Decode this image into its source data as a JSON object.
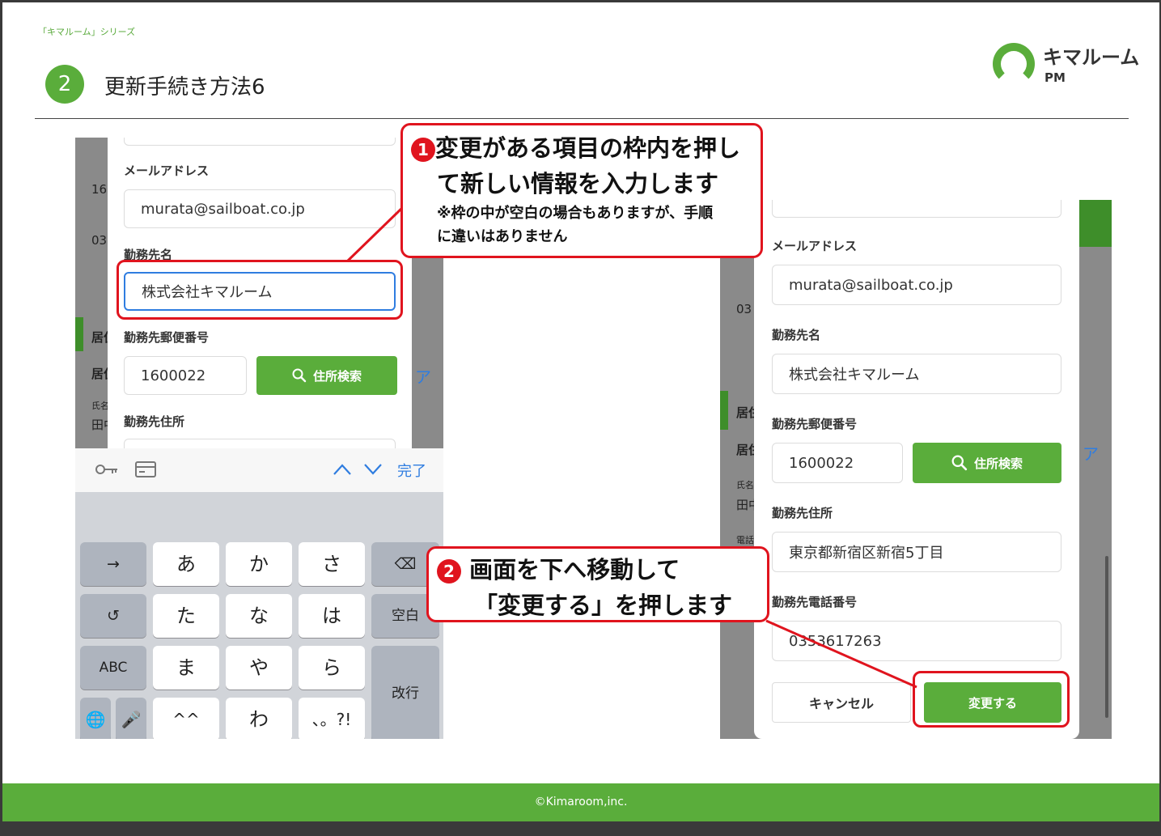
{
  "header": {
    "series": "「キマルーム」シリーズ",
    "step_number": "2",
    "title": "更新手続き方法6"
  },
  "logo": {
    "name": "キマルーム",
    "sub": "PM"
  },
  "footer": {
    "copyright": "©Kimaroom,inc."
  },
  "left_screen": {
    "background_fragments": [
      "16",
      "03",
      "居住",
      "居住",
      "氏名",
      "田中",
      "ア"
    ],
    "email_label": "メールアドレス",
    "email_value": "murata@sailboat.co.jp",
    "company_label": "勤務先名",
    "company_value": "株式会社キマルーム",
    "zip_label": "勤務先郵便番号",
    "zip_value": "1600022",
    "address_search_button": "住所検索",
    "address_label": "勤務先住所",
    "keyboard_toolbar": {
      "done": "完了"
    },
    "keyboard": {
      "row1": [
        "→",
        "あ",
        "か",
        "さ",
        "⌫"
      ],
      "row2": [
        "↺",
        "た",
        "な",
        "は",
        "空白"
      ],
      "row3": [
        "ABC",
        "ま",
        "や",
        "ら"
      ],
      "row4": [
        "🌐",
        "🎤",
        "^^",
        "わ",
        "、。?!"
      ],
      "enter": "改行"
    }
  },
  "right_screen": {
    "background_fragments": [
      "03",
      "居住",
      "居住",
      "氏名",
      "田中",
      "電話",
      "ア"
    ],
    "email_label": "メールアドレス",
    "email_value": "murata@sailboat.co.jp",
    "company_label": "勤務先名",
    "company_value": "株式会社キマルーム",
    "zip_label": "勤務先郵便番号",
    "zip_value": "1600022",
    "address_search_button": "住所検索",
    "address_label": "勤務先住所",
    "address_value": "東京都新宿区新宿5丁目",
    "phone_label": "勤務先電話番号",
    "phone_value": "0353617263",
    "cancel_button": "キャンセル",
    "submit_button": "変更する"
  },
  "callout1": {
    "badge": "1",
    "line1": "変更がある項目の枠内を押し",
    "line2": "て新しい情報を入力します",
    "note1": "※枠の中が空白の場合もありますが、手順",
    "note2": "に違いはありません"
  },
  "callout2": {
    "badge": "2",
    "line1": "画面を下へ移動して",
    "line2": "「変更する」を押します"
  },
  "colors": {
    "brand_green": "#5aad3b",
    "callout_red": "#e0141e",
    "link_blue": "#2f7de0"
  },
  "icons": [
    "search-icon",
    "key-icon",
    "card-icon",
    "chevron-up-icon",
    "chevron-down-icon",
    "backspace-icon",
    "undo-icon",
    "globe-icon",
    "mic-icon"
  ]
}
